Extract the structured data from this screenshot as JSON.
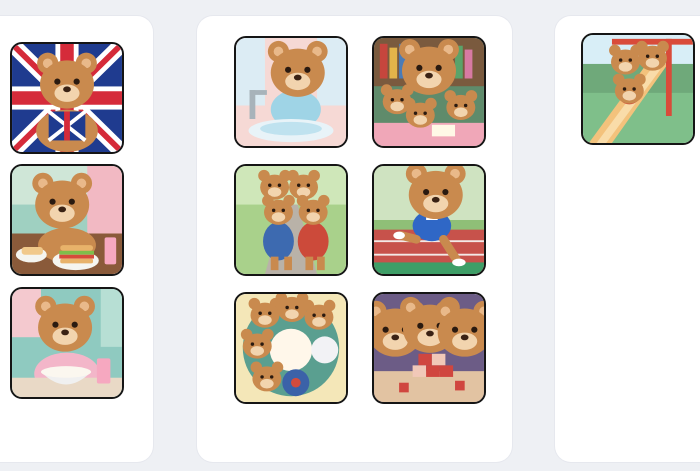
{
  "board": {
    "columns": [
      {
        "name": "left-column",
        "cards": [
          {
            "icon": "bear-union-jack-icon"
          },
          {
            "icon": "bear-sandwich-icon"
          },
          {
            "icon": "bear-cereal-bowl-icon"
          }
        ]
      },
      {
        "name": "middle-column",
        "cards": [
          {
            "icon": "bear-washing-hands-icon"
          },
          {
            "icon": "bear-family-reading-icon"
          },
          {
            "icon": "bears-walking-together-icon"
          },
          {
            "icon": "bear-running-track-icon"
          },
          {
            "icon": "bears-circle-playing-icon"
          },
          {
            "icon": "bears-building-blocks-icon"
          }
        ]
      },
      {
        "name": "right-column",
        "cards": [
          {
            "icon": "bears-playground-slide-icon"
          }
        ]
      }
    ]
  },
  "colors": {
    "page_background": "#eef0f4",
    "panel_background": "#ffffff",
    "tile_border": "#151515",
    "bear_fur": "#c98a4e",
    "bear_muzzle": "#f2d4ae"
  }
}
